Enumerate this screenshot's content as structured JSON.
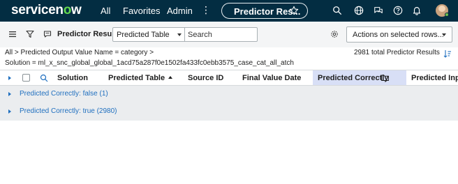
{
  "nav": {
    "logo": "servicenow",
    "links": [
      "All",
      "Favorites",
      "Admin"
    ],
    "more_icon": "vertical-dots-icon",
    "pill_title": "Predictor Res...",
    "icons": [
      "search-icon",
      "globe-icon",
      "chat-icon",
      "help-icon",
      "bell-icon"
    ]
  },
  "toolbar": {
    "title": "Predictor Results",
    "field_select": "Predicted Table",
    "search_placeholder": "Search",
    "actions_label": "Actions on selected rows..."
  },
  "breadcrumb": {
    "all": "All",
    "condition1": "Predicted Output Value Name = category",
    "separator": ">",
    "condition2": "Solution = ml_x_snc_global_global_1acd75a287f0e1502fa433fc0ebb3575_case_cat_all_atch",
    "total": "2981 total Predictor Results"
  },
  "columns": [
    "Solution",
    "Predicted Table",
    "Source ID",
    "Final Value Date",
    "Predicted Correctly",
    "Predicted Input"
  ],
  "groups": [
    {
      "label": "Predicted Correctly: false (1)"
    },
    {
      "label": "Predicted Correctly: true (2980)"
    }
  ],
  "colors": {
    "nav_bg": "#032d42",
    "logo_accent": "#62d84e",
    "link_blue": "#1f6fbf",
    "highlight_col": "#d8dff6"
  }
}
